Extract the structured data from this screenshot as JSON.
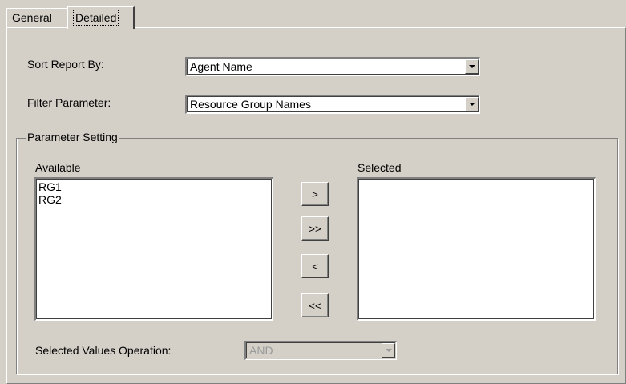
{
  "tabs": [
    {
      "label": "General"
    },
    {
      "label": "Detailed"
    }
  ],
  "sort": {
    "label": "Sort Report By:",
    "value": "Agent Name"
  },
  "filter": {
    "label": "Filter Parameter:",
    "value": "Resource Group Names"
  },
  "parameter_setting": {
    "legend": "Parameter Setting",
    "available_label": "Available",
    "available_items": [
      "RG1",
      "RG2"
    ],
    "selected_label": "Selected",
    "selected_items": [],
    "buttons": {
      "add": ">",
      "add_all": ">>",
      "remove": "<",
      "remove_all": "<<"
    }
  },
  "operation": {
    "label": "Selected Values Operation:",
    "value": "AND"
  },
  "icons": {
    "dropdown": "chevron-down-icon"
  }
}
